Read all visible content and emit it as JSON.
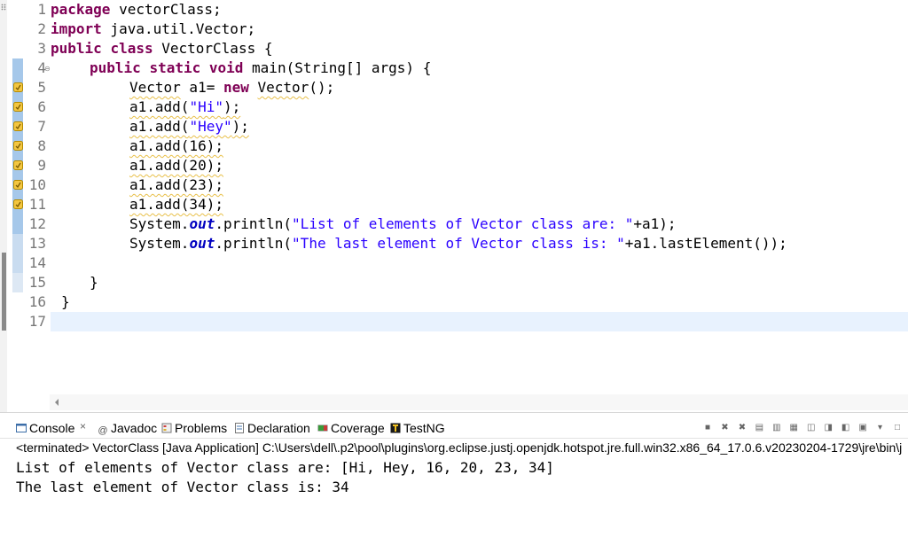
{
  "editor": {
    "line_numbers": [
      "1",
      "2",
      "3",
      "4",
      "5",
      "6",
      "7",
      "8",
      "9",
      "10",
      "11",
      "12",
      "13",
      "14",
      "15",
      "16",
      "17"
    ],
    "line1": {
      "kw": "package",
      "rest": " vectorClass;"
    },
    "line2": {
      "kw": "import",
      "rest": " java.util.Vector;"
    },
    "line3": {
      "kw1": "public",
      "kw2": "class",
      "rest": " VectorClass {"
    },
    "line4": {
      "kw1": "public",
      "kw2": "static",
      "kw3": "void",
      "rest": " main(String[] args) {"
    },
    "line5": {
      "type": "Vector",
      "mid": " a1= ",
      "kw": "new",
      "ctor": "Vector",
      "end": "();"
    },
    "line6": {
      "call": "a1.add(",
      "str": "\"Hi\"",
      "end": ");"
    },
    "line7": {
      "call": "a1.add(",
      "str": "\"Hey\"",
      "end": ");"
    },
    "line8": {
      "call": "a1.add(16);"
    },
    "line9": {
      "call": "a1.add(20);"
    },
    "line10": {
      "call": "a1.add(23);"
    },
    "line11": {
      "call": "a1.add(34);"
    },
    "line12": {
      "pre": "System.",
      "fld": "out",
      "mid": ".println(",
      "str": "\"List of elements of Vector class are: \"",
      "end": "+a1);"
    },
    "line13": {
      "pre": "System.",
      "fld": "out",
      "mid": ".println(",
      "str": "\"The last element of Vector class is: \"",
      "end": "+a1.lastElement());"
    },
    "line15": {
      "text": "}"
    },
    "line16": {
      "text": "}"
    },
    "fold_marker": "⊖"
  },
  "console": {
    "tabs": {
      "console": "Console",
      "javadoc": "Javadoc",
      "problems": "Problems",
      "declaration": "Declaration",
      "coverage": "Coverage",
      "testng": "TestNG"
    },
    "close_glyph": "×",
    "terminated_line": "<terminated> VectorClass [Java Application] C:\\Users\\dell\\.p2\\pool\\plugins\\org.eclipse.justj.openjdk.hotspot.jre.full.win32.x86_64_17.0.6.v20230204-1729\\jre\\bin\\j",
    "output": [
      "List of elements of Vector class are: [Hi, Hey, 16, 20, 23, 34]",
      "The last element of Vector class is: 34"
    ]
  },
  "colors": {
    "keyword": "#7f0055",
    "string": "#2a00ff",
    "field": "#0000c0",
    "current_line": "#e8f2fe",
    "annotation_band": "#a6c8ea",
    "warning_underline": "#e8c04a"
  },
  "icons": {
    "console_tab": "console-icon",
    "javadoc_tab": "javadoc-at-icon",
    "problems_tab": "problems-icon",
    "declaration_tab": "declaration-icon",
    "coverage_tab": "coverage-icon",
    "testng_tab": "testng-icon",
    "gutter_warning": "warning-lightbulb-icon"
  }
}
